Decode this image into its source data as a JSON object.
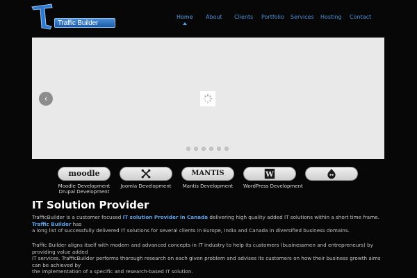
{
  "brand": {
    "logo_text": "Traffic Builder",
    "accent": "#1c5aa8",
    "link_color": "#4b8fd9"
  },
  "nav": {
    "items": [
      {
        "label": "Home",
        "active": true
      },
      {
        "label": "About"
      },
      {
        "label": "Clients"
      },
      {
        "label": "Portfolio"
      },
      {
        "label": "Services"
      },
      {
        "label": "Hosting"
      },
      {
        "label": "Contact"
      }
    ]
  },
  "slider": {
    "prev_icon": "chevron-left-icon",
    "loader_icon": "loading-spinner-icon",
    "slide_count": 6
  },
  "services": [
    {
      "logo_text": "moodle",
      "label": "Moodle Development",
      "icon": "moodle-logo"
    },
    {
      "logo_text": "",
      "label": "Joomla Development",
      "icon": "joomla-logo"
    },
    {
      "logo_text": "MANTIS",
      "label": "Mantis Development",
      "icon": "mantis-logo"
    },
    {
      "logo_text": "",
      "label": "WordPress Development",
      "icon": "wordpress-logo"
    },
    {
      "logo_text": "",
      "label": "Drupal Development",
      "icon": "drupal-logo"
    }
  ],
  "content": {
    "title": "IT Solution Provider",
    "p1_a": "TrafficBuilder is a customer focused ",
    "p1_link": "IT solution Provider in Canada",
    "p1_b": " delivering high quality added IT solutions within a short time frame. ",
    "p1_link2": "Traffic Builder",
    "p1_c": " has",
    "p1_d": "a long list of successfully delivered IT solutions for several clients in Europe, India and Canada in diversified business domains.",
    "p2_a": "Traffic Builder aligns itself with modern and advanced concepts in IT industry to help its customers (businessmen and entrepreneurs) by providing value added",
    "p2_b": "IT services. TrafficBuilder performs thorough research on each given problem and advises its customers on how their business growth aims can be achieved by",
    "p2_c": "the implementation of a specific and research-based IT solution."
  }
}
